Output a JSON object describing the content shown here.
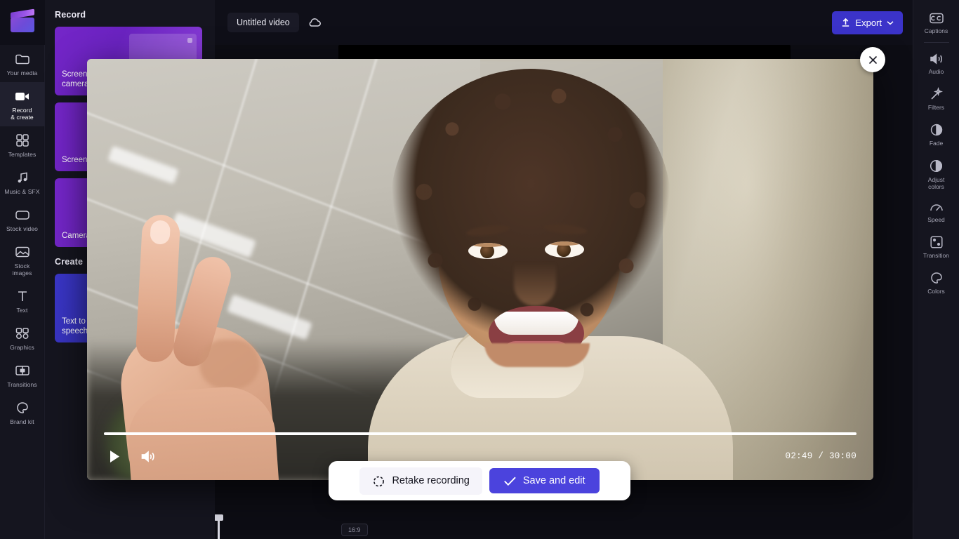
{
  "app": {
    "name": "Clipchamp",
    "logo_icon": "clapperboard-icon"
  },
  "left_rail": {
    "items": [
      {
        "label": "Your media",
        "icon": "media-folder-icon",
        "active": false
      },
      {
        "label": "Record\n& create",
        "line1": "Record",
        "line2": "& create",
        "icon": "video-camera-icon",
        "active": true
      },
      {
        "label": "Templates",
        "icon": "grid-templates-icon",
        "active": false
      },
      {
        "label": "Music & SFX",
        "icon": "music-note-icon",
        "active": false
      },
      {
        "label": "Stock video",
        "icon": "stock-video-icon",
        "active": false
      },
      {
        "label": "Stock images",
        "line1": "Stock",
        "line2": "images",
        "icon": "stock-image-icon",
        "active": false
      },
      {
        "label": "Text",
        "icon": "text-icon",
        "active": false
      },
      {
        "label": "Graphics",
        "icon": "graphics-icon",
        "active": false
      },
      {
        "label": "Transitions",
        "icon": "transitions-icon",
        "active": false
      },
      {
        "label": "Brand kit",
        "icon": "brand-kit-icon",
        "active": false
      }
    ]
  },
  "panel": {
    "section_record": "Record",
    "section_create": "Create",
    "cards": [
      {
        "label": "Screen &\ncamera",
        "line1": "Screen &",
        "line2": "camera"
      },
      {
        "label": "Screen",
        "line1": "Screen",
        "line2": ""
      },
      {
        "label": "Camera",
        "line1": "Camera",
        "line2": ""
      },
      {
        "label": "Text to speech",
        "line1": "Text to",
        "line2": "speech"
      }
    ]
  },
  "topbar": {
    "project_title": "Untitled video",
    "cloud_icon": "cloud-sync-icon",
    "export_label": "Export",
    "export_icon": "upload-icon",
    "export_chevron": "chevron-down-icon"
  },
  "right_rail": {
    "items": [
      {
        "label": "Captions",
        "icon": "captions-icon"
      },
      {
        "label": "Audio",
        "icon": "speaker-icon"
      },
      {
        "label": "Filters",
        "icon": "magic-wand-icon"
      },
      {
        "label": "Fade",
        "icon": "fade-circle-icon"
      },
      {
        "label": "Adjust colors",
        "line1": "Adjust",
        "line2": "colors",
        "icon": "contrast-circle-icon"
      },
      {
        "label": "Speed",
        "icon": "speedometer-icon"
      },
      {
        "label": "Transition",
        "icon": "transition-squares-icon"
      },
      {
        "label": "Colors",
        "icon": "color-palette-icon"
      }
    ]
  },
  "stage": {
    "help_icon": "question-mark-icon",
    "expand_icon": "expand-arrows-icon",
    "aspect_ratio_badge": "16:9"
  },
  "preview": {
    "close_icon": "close-icon",
    "play_icon": "play-icon",
    "volume_icon": "volume-on-icon",
    "current_time": "02:49",
    "duration": "30:00",
    "time_separator": "/",
    "progress_percent": 100
  },
  "actions": {
    "retake_label": "Retake recording",
    "retake_icon": "retake-circular-arrow-icon",
    "save_label": "Save and edit",
    "save_icon": "checkmark-icon"
  },
  "colors": {
    "accent_purple": "#4b43dd",
    "export_blue": "#3b33c9",
    "panel_bg": "#15151f",
    "stage_bg": "#0d0d14",
    "card_purple": "#7526c9",
    "card_blue": "#3a36c8"
  }
}
